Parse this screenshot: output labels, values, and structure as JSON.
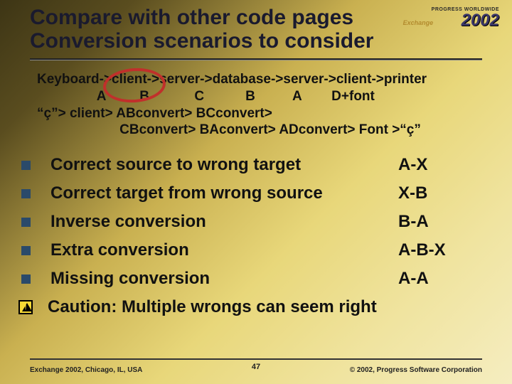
{
  "title": {
    "line1": "Compare with other code pages",
    "line2": "Conversion scenarios to consider"
  },
  "logo": {
    "small": "PROGRESS WORLDWIDE",
    "exchange": "Exchange",
    "year": "2002"
  },
  "body": {
    "line1": "Keyboard->client->server->database->server->client->printer",
    "line2": "                A         B            C           B          A        D+font",
    "line3": "“ç”> client> ABconvert> BCconvert>",
    "line4": "                      CBconvert> BAconvert> ADconvert> Font >“ç”"
  },
  "bullets": [
    {
      "text": "Correct source to wrong target",
      "code": "A-X"
    },
    {
      "text": "Correct target from wrong source",
      "code": "X-B"
    },
    {
      "text": "Inverse conversion",
      "code": "B-A"
    },
    {
      "text": "Extra conversion",
      "code": "A-B-X"
    },
    {
      "text": "Missing conversion",
      "code": "A-A"
    }
  ],
  "caution": {
    "text": "Caution: Multiple wrongs can seem right"
  },
  "footer": {
    "left": "Exchange 2002, Chicago, IL, USA",
    "center": "47",
    "right": "© 2002, Progress Software Corporation"
  }
}
